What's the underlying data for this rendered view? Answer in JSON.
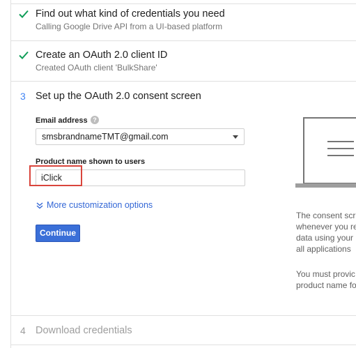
{
  "steps": [
    {
      "status": "done",
      "title": "Find out what kind of credentials you need",
      "subtitle": "Calling Google Drive API from a UI-based platform"
    },
    {
      "status": "done",
      "title": "Create an OAuth 2.0 client ID",
      "subtitle": "Created OAuth client 'BulkShare'"
    },
    {
      "status": "active",
      "number": "3",
      "title": "Set up the OAuth 2.0 consent screen"
    },
    {
      "status": "pending",
      "number": "4",
      "title": "Download credentials"
    }
  ],
  "consent_form": {
    "email_label": "Email address",
    "help_glyph": "?",
    "email_value": "smsbrandnameTMT@gmail.com",
    "product_name_label": "Product name shown to users",
    "product_name_value": "iClick",
    "more_options_label": "More customization options",
    "continue_label": "Continue"
  },
  "side_panel": {
    "lines_1": [
      "The consent scr",
      "whenever you re",
      "data using your",
      "all applications"
    ],
    "lines_2": [
      "You must provic",
      "product name fo"
    ]
  },
  "colors": {
    "check": "#0f9d58",
    "accent": "#4285f4",
    "button": "#3a6fd8",
    "highlight": "#d9453c"
  },
  "icons": {
    "done": "check-icon",
    "help": "help-icon",
    "expand": "double-chevron-down-icon",
    "dropdown": "caret-down-icon",
    "illustration": "laptop-illustration"
  }
}
